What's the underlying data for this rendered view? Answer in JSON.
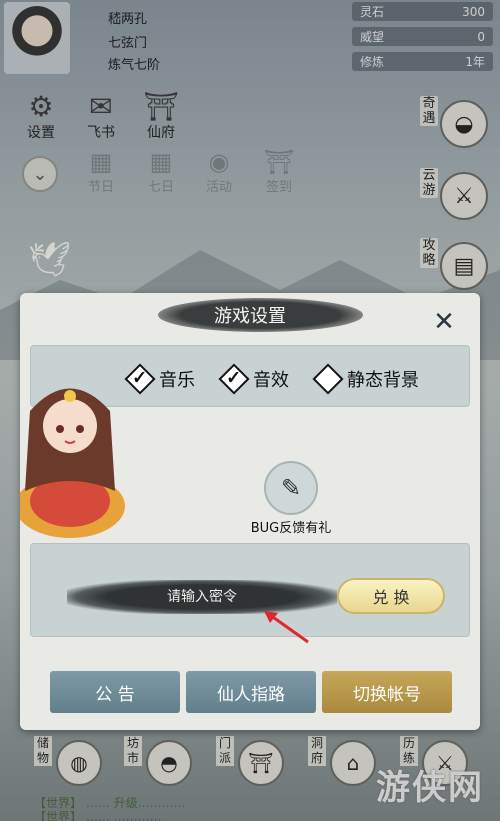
{
  "player": {
    "name": "嵇两孔",
    "sect": "七弦门",
    "realm": "炼气七阶"
  },
  "stats": [
    {
      "label": "灵石",
      "value": "300"
    },
    {
      "label": "威望",
      "value": "0"
    },
    {
      "label": "修炼",
      "value": "1年"
    }
  ],
  "top_icons": [
    {
      "label": "设置",
      "icon": "gear-icon"
    },
    {
      "label": "飞书",
      "icon": "mail-icon"
    },
    {
      "label": "仙府",
      "icon": "pavilion-icon"
    }
  ],
  "faded_icons": [
    "节日",
    "七日",
    "活动",
    "签到"
  ],
  "side_buttons": [
    {
      "label": "奇遇",
      "icon": "bowl-icon"
    },
    {
      "label": "云游",
      "icon": "sword-icon"
    },
    {
      "label": "攻略",
      "icon": "book-icon"
    }
  ],
  "bottom_icons": [
    {
      "label": "储物",
      "icon": "bag-icon"
    },
    {
      "label": "坊市",
      "icon": "ingot-icon"
    },
    {
      "label": "门派",
      "icon": "gate-icon"
    },
    {
      "label": "洞府",
      "icon": "temple-icon"
    },
    {
      "label": "历练",
      "icon": "swords-icon"
    }
  ],
  "chat": [
    "【世界】 …… 升级…………",
    "【世界】 …… …………"
  ],
  "watermark": "游侠网",
  "dialog": {
    "title": "游戏设置",
    "options": [
      {
        "label": "音乐",
        "checked": true
      },
      {
        "label": "音效",
        "checked": true
      },
      {
        "label": "静态背景",
        "checked": false
      }
    ],
    "bug_feedback_label": "BUG反馈有礼",
    "code_placeholder": "请输入密令",
    "redeem_label": "兑 换",
    "footer_buttons": [
      "公 告",
      "仙人指路",
      "切换帐号"
    ]
  }
}
